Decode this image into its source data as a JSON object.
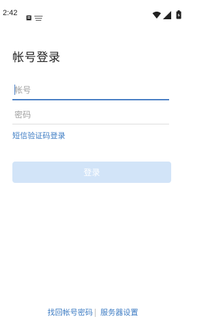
{
  "status_bar": {
    "time": "2:42",
    "icons": [
      "notification-a-icon",
      "notification-b-icon",
      "wifi-icon",
      "signal-icon",
      "battery-icon"
    ]
  },
  "login": {
    "title": "帐号登录",
    "account_placeholder": "帐号",
    "password_placeholder": "密码",
    "sms_login_label": "短信验证码登录",
    "login_button_label": "登录"
  },
  "footer": {
    "find_account_label": "找回帐号密码",
    "divider": "|",
    "server_settings_label": "服务器设置"
  },
  "colors": {
    "accent": "#3f7dc4",
    "button_disabled": "#d2e4f8",
    "text_primary": "#222222",
    "placeholder": "#9f9f9f",
    "field_divider": "#dddddd"
  }
}
